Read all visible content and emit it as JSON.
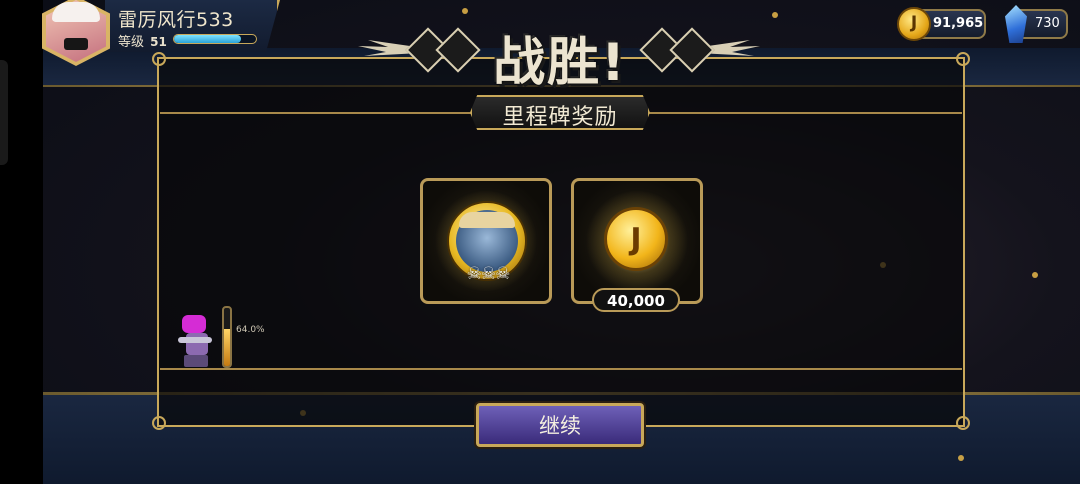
{
  "player": {
    "name": "雷厉风行533",
    "level_label": "等级",
    "level": "51",
    "xp_fraction": 0.82
  },
  "currency": {
    "coins": "91,965",
    "gems": "730",
    "coin_symbol": "J"
  },
  "result": {
    "title": "战胜!",
    "subtitle": "里程碑奖励"
  },
  "rewards": [
    {
      "icon": "medal-icon",
      "badge": "☠☠☠"
    },
    {
      "icon": "coin-icon",
      "amount": "40,000",
      "symbol": "J"
    }
  ],
  "progress": {
    "percent_label": "64.0%",
    "fraction": 0.64
  },
  "actions": {
    "continue_label": "继续"
  },
  "colors": {
    "gold": "#c8a85a",
    "button_purple": "#5a4aa0",
    "xp_blue": "#2aa2d8"
  }
}
